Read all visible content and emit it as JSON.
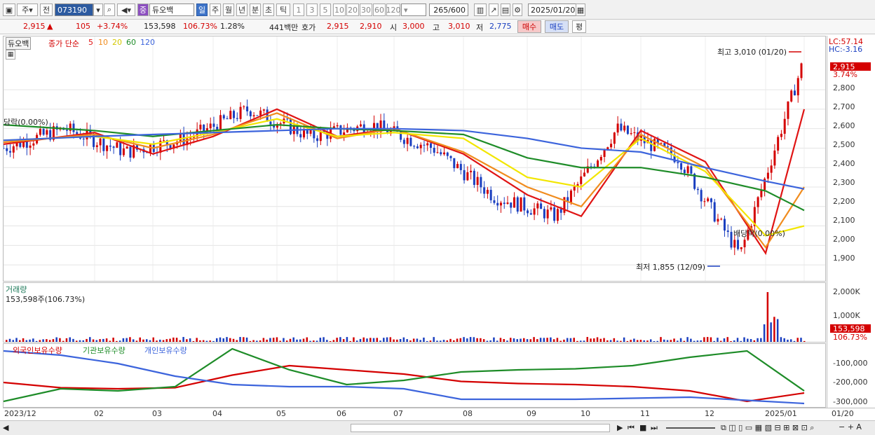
{
  "toolbar": {
    "period": "주",
    "prev": "전",
    "code": "073190",
    "name": "듀오백",
    "badge": "중",
    "periods": [
      "일",
      "주",
      "월",
      "년",
      "분",
      "초",
      "틱"
    ],
    "intervals": [
      "1",
      "3",
      "5",
      "10",
      "20",
      "30",
      "60",
      "120"
    ],
    "count": "265",
    "count_total": "/600",
    "date": "2025/01/20"
  },
  "quote": {
    "price": "2,915",
    "change": "105",
    "pct": "+3.74%",
    "volume": "153,598",
    "vol_ratio": "106.73%",
    "turnover": "1.28%",
    "amount": "441백만",
    "bid_label": "호가",
    "ask": "2,915",
    "bid": "2,910",
    "open_label": "시",
    "open": "3,000",
    "high_label": "고",
    "high": "3,010",
    "low_label": "저",
    "low": "2,775",
    "buy": "매수",
    "sell": "매도",
    "eval": "평"
  },
  "price_chart": {
    "legend_name": "듀오백",
    "legend_ma": "종가 단순",
    "ma_periods": [
      "5",
      "10",
      "20",
      "60",
      "120"
    ],
    "lc": "LC:57.14",
    "hc": "HC:-3.16",
    "high_note": "최고 3,010 (01/20)",
    "low_note": "최저 1,855 (12/09)",
    "div_note1": "당락(0.00%)",
    "div_note2": "배당락(0.00%)",
    "current": "2,915",
    "current_pct": "3.74%",
    "yticks": [
      "2,800",
      "2,700",
      "2,600",
      "2,500",
      "2,400",
      "2,300",
      "2,200",
      "2,100",
      "2,000",
      "1,900"
    ]
  },
  "volume_chart": {
    "title": "거래량",
    "info": "153,598주(106.73%)",
    "yticks": [
      "2,000K",
      "1,000K"
    ],
    "current": "153,598",
    "current_pct": "106.73%"
  },
  "holding_chart": {
    "legend": [
      "외국인보유수량",
      "기관보유수량",
      "개인보유수량"
    ],
    "yticks": [
      "-100,000",
      "-200,000",
      "-300,000"
    ]
  },
  "x_axis": [
    "2023/12",
    "02",
    "03",
    "04",
    "05",
    "06",
    "07",
    "08",
    "09",
    "10",
    "11",
    "12",
    "2025/01",
    "01/20"
  ],
  "colors": {
    "up": "#d40000",
    "down": "#1a3fc0",
    "ma5": "#e01414",
    "ma10": "#f08c1e",
    "ma20": "#f2e600",
    "ma60": "#1e8c28",
    "ma120": "#3c64dc"
  },
  "chart_data": {
    "type": "line",
    "title": "",
    "x": [
      "2023/12",
      "02",
      "03",
      "04",
      "05",
      "06",
      "07",
      "08",
      "09",
      "10",
      "11",
      "12",
      "2025/01",
      "01/20"
    ],
    "ylim": [
      1850,
      3020
    ],
    "series": [
      {
        "name": "종가",
        "values": [
          2500,
          2600,
          2480,
          2550,
          2700,
          2560,
          2620,
          2500,
          2250,
          2150,
          2600,
          2450,
          1950,
          2915
        ]
      },
      {
        "name": "5",
        "values": [
          2520,
          2580,
          2470,
          2560,
          2700,
          2560,
          2600,
          2470,
          2260,
          2150,
          2590,
          2430,
          1960,
          2700
        ]
      },
      {
        "name": "10",
        "values": [
          2530,
          2570,
          2500,
          2570,
          2680,
          2550,
          2600,
          2480,
          2300,
          2200,
          2570,
          2400,
          1990,
          2300
        ]
      },
      {
        "name": "20",
        "values": [
          2540,
          2560,
          2520,
          2580,
          2650,
          2560,
          2580,
          2550,
          2350,
          2300,
          2550,
          2380,
          2050,
          2100
        ]
      },
      {
        "name": "60",
        "values": [
          2620,
          2590,
          2560,
          2590,
          2620,
          2600,
          2590,
          2570,
          2450,
          2400,
          2400,
          2350,
          2280,
          2180
        ]
      },
      {
        "name": "120",
        "values": [
          2540,
          2560,
          2570,
          2580,
          2590,
          2600,
          2600,
          2590,
          2550,
          2500,
          2480,
          2400,
          2330,
          2290
        ]
      }
    ]
  }
}
